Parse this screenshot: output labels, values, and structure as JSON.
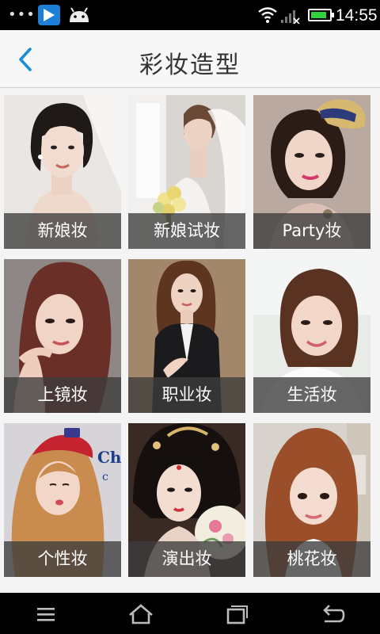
{
  "status_bar": {
    "time": "14:55",
    "battery_level": 0.85,
    "icons": [
      "more-dots-icon",
      "video-player-icon",
      "android-icon",
      "wifi-icon",
      "signal-icon",
      "battery-icon"
    ]
  },
  "header": {
    "title": "彩妆造型",
    "back_icon": "chevron-left-icon",
    "accent_color": "#1a8fd6"
  },
  "tiles": [
    {
      "label": "新娘妆",
      "photo": "bride-portrait"
    },
    {
      "label": "新娘试妆",
      "photo": "bride-with-bouquet"
    },
    {
      "label": "Party妆",
      "photo": "woman-with-straw-hat"
    },
    {
      "label": "上镜妆",
      "photo": "woman-long-wavy-hair"
    },
    {
      "label": "职业妆",
      "photo": "woman-in-business-suit"
    },
    {
      "label": "生活妆",
      "photo": "woman-short-bob"
    },
    {
      "label": "个性妆",
      "photo": "woman-with-red-cap"
    },
    {
      "label": "演出妆",
      "photo": "woman-in-costume-headdress"
    },
    {
      "label": "桃花妆",
      "photo": "woman-with-bangs"
    }
  ],
  "nav_bar": {
    "icons": [
      "menu-icon",
      "home-icon",
      "recent-apps-icon",
      "back-icon"
    ]
  }
}
